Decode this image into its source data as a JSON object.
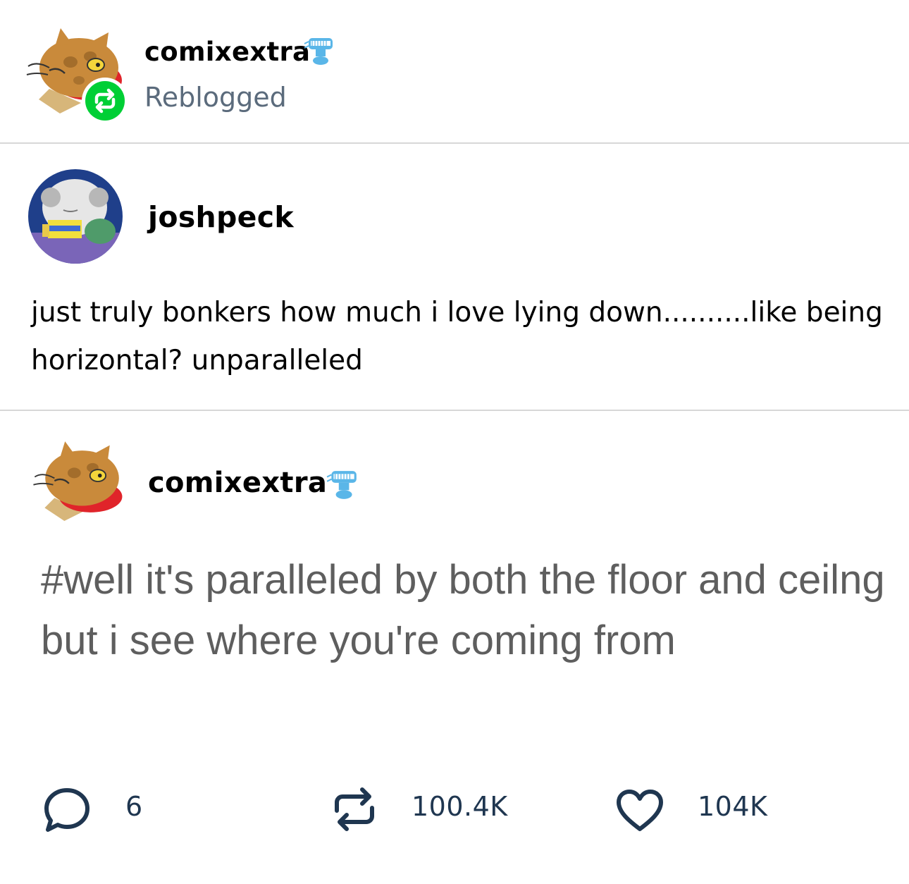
{
  "reblog_header": {
    "username": "comixextra",
    "status": "Reblogged",
    "avatar_icon": "cat-avatar",
    "badge_icon": "reblog-icon",
    "badge_color": "#00cf35",
    "user_badge_icon": "teeth-emoji-icon"
  },
  "original_post": {
    "username": "joshpeck",
    "avatar_icon": "spongebob-avatar",
    "text": "just truly bonkers how much i love lying down..........like being horizontal? unparalleled"
  },
  "reply_post": {
    "username": "comixextra",
    "avatar_icon": "cat-avatar",
    "user_badge_icon": "teeth-emoji-icon",
    "tags": "#well it's paralleled by both the floor and ceilng but i see where you're coming from"
  },
  "actions": {
    "comments": {
      "icon": "comment-icon",
      "count": "6"
    },
    "reblogs": {
      "icon": "reblog-icon",
      "count": "100.4K"
    },
    "likes": {
      "icon": "heart-icon",
      "count": "104K"
    }
  },
  "colors": {
    "text": "#000000",
    "muted": "#5b6b7c",
    "tag_text": "#5e5e5e",
    "action": "#1f3650",
    "divider": "#d7d7d7"
  }
}
